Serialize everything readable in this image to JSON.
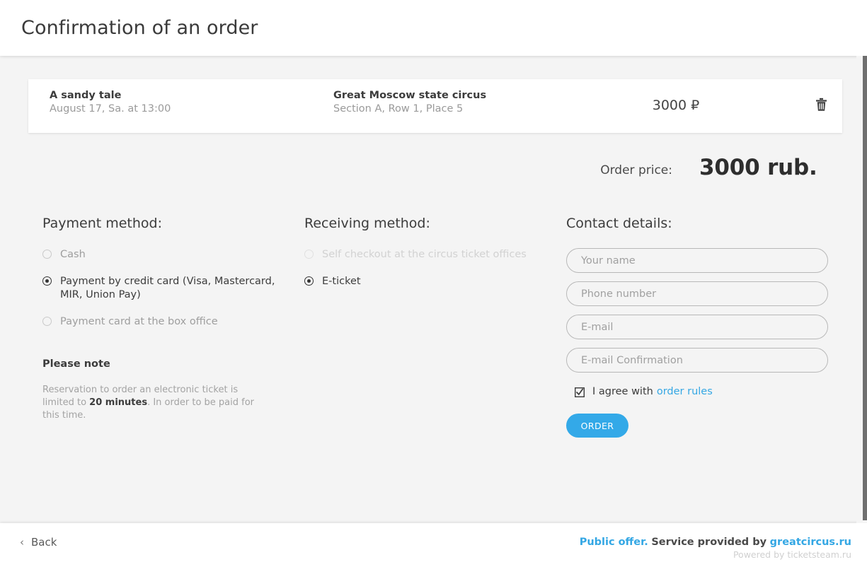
{
  "header": {
    "title": "Confirmation of an order"
  },
  "ticket": {
    "event_title": "A sandy tale",
    "event_datetime": "August 17, Sa. at 13:00",
    "venue_title": "Great Moscow state circus",
    "venue_seat": "Section A, Row 1, Place 5",
    "price": "3000 ₽",
    "delete_icon": "trash-icon"
  },
  "order_total": {
    "label": "Order price:",
    "value": "3000 rub."
  },
  "payment": {
    "heading": "Payment method:",
    "options": [
      {
        "label": "Cash",
        "selected": false,
        "state": "muted"
      },
      {
        "label": "Payment by credit card (Visa, Mastercard, MIR, Union Pay)",
        "selected": true,
        "state": "active"
      },
      {
        "label": "Payment card at the box office",
        "selected": false,
        "state": "muted"
      }
    ],
    "note_title": "Please note",
    "note_text_before": "Reservation to order an electronic ticket is limited to ",
    "note_text_bold": "20 minutes",
    "note_text_after": ". In order to be paid for this time."
  },
  "receiving": {
    "heading": "Receiving method:",
    "options": [
      {
        "label": "Self checkout at the circus ticket offices",
        "selected": false,
        "state": "faded"
      },
      {
        "label": "E-ticket",
        "selected": true,
        "state": "active"
      }
    ]
  },
  "contact": {
    "heading": "Contact details:",
    "fields": [
      {
        "name": "your-name",
        "placeholder": "Your name",
        "value": ""
      },
      {
        "name": "phone-number",
        "placeholder": "Phone number",
        "value": ""
      },
      {
        "name": "email",
        "placeholder": "E-mail",
        "value": ""
      },
      {
        "name": "email-confirmation",
        "placeholder": "E-mail Confirmation",
        "value": ""
      }
    ],
    "agree_checked": true,
    "agree_text": "I agree with",
    "agree_link": "order rules",
    "submit_label": "ORDER"
  },
  "footer": {
    "back_label": "Back",
    "back_chevron": "‹",
    "public_offer": "Public offer.",
    "service_text": "Service provided by",
    "provider_link": "greatcircus.ru",
    "powered_by": "Powered by ticketsteam.ru"
  },
  "colors": {
    "accent_blue": "#33a9e8",
    "page_background": "#f4f4f4",
    "card_background": "#ffffff",
    "text_primary": "#3c3c3c",
    "text_muted": "#9a9a9a",
    "text_faded": "#d2d2d2",
    "scrollbar_thumb": "#6f6f6f"
  }
}
